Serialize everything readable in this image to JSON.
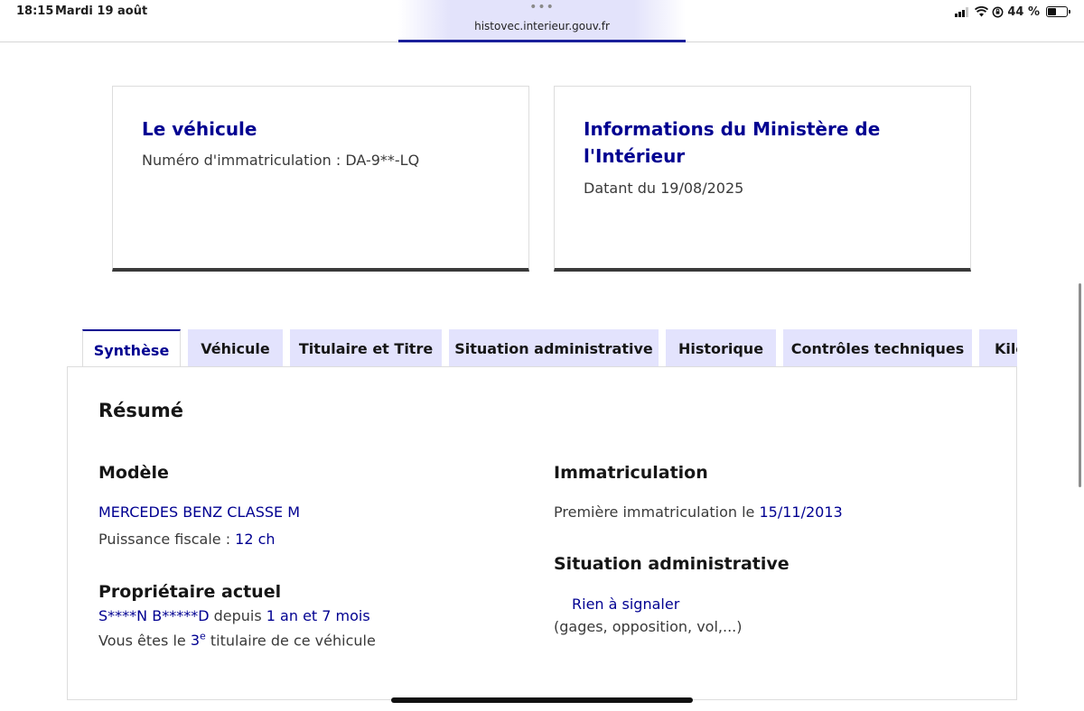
{
  "status_bar": {
    "time": "18:15",
    "date": "Mardi 19 août",
    "battery": "44 %",
    "tab_dots": "•••",
    "url": "histovec.interieur.gouv.fr"
  },
  "cards": {
    "vehicle": {
      "title": "Le véhicule",
      "plate_label": "Numéro d'immatriculation : DA-9**-LQ"
    },
    "ministry": {
      "title": "Informations du Ministère de l'Intérieur",
      "date_label": "Datant du 19/08/2025"
    }
  },
  "tabs": [
    {
      "label": "Synthèse",
      "active": true
    },
    {
      "label": "Véhicule",
      "active": false
    },
    {
      "label": "Titulaire et Titre",
      "active": false
    },
    {
      "label": "Situation administrative",
      "active": false
    },
    {
      "label": "Historique",
      "active": false
    },
    {
      "label": "Contrôles techniques",
      "active": false
    },
    {
      "label": "Kilométrage",
      "active": false
    }
  ],
  "summary": {
    "title": "Résumé",
    "model": {
      "heading": "Modèle",
      "name": "MERCEDES BENZ CLASSE M",
      "fiscal_label": "Puissance fiscale : ",
      "fiscal_value": "12 ch"
    },
    "owner": {
      "heading": "Propriétaire actuel",
      "name": "S****N B*****D",
      "since_label": " depuis ",
      "since_value": "1 an et 7 mois",
      "rank_prefix": "Vous êtes le ",
      "rank_value": "3",
      "rank_suffix": "e",
      "rank_after": " titulaire de ce véhicule"
    },
    "registration": {
      "heading": "Immatriculation",
      "first_label": "Première immatriculation le ",
      "first_date": "15/11/2013"
    },
    "admin": {
      "heading": "Situation administrative",
      "status": "Rien à signaler",
      "detail": "(gages, opposition, vol,...)"
    }
  }
}
